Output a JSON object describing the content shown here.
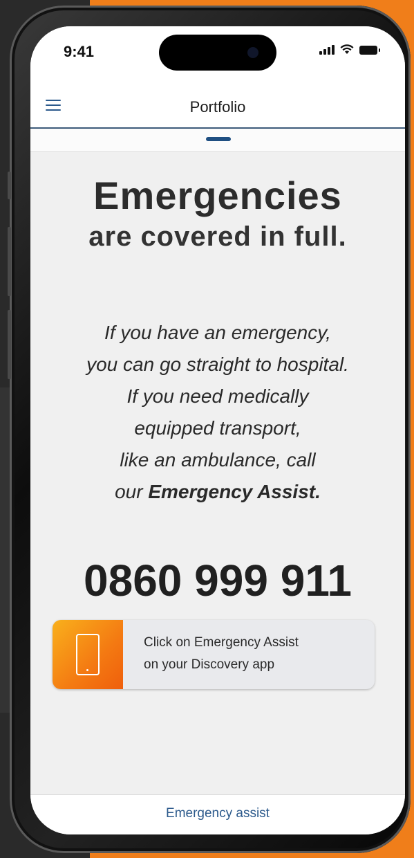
{
  "status_bar": {
    "time": "9:41"
  },
  "app_bar": {
    "title": "Portfolio"
  },
  "content": {
    "headline": "Emergencies",
    "subheadline": "are covered in full.",
    "body_lines": [
      "If you have an emergency,",
      "you can go straight to hospital.",
      "If you need medically",
      "equipped transport,",
      "like an ambulance, call"
    ],
    "body_last_prefix": "our ",
    "body_last_bold": "Emergency Assist.",
    "phone_number": "0860 999 911"
  },
  "cta": {
    "line1": "Click on Emergency Assist",
    "line2": "on your Discovery app"
  },
  "bottom_bar": {
    "label": "Emergency assist"
  },
  "colors": {
    "accent_blue": "#2c5a8c",
    "brand_orange": "#f47a12"
  }
}
